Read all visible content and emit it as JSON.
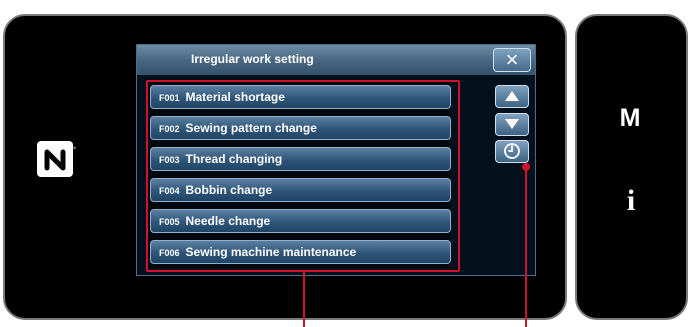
{
  "sidebar": {
    "m_label": "M",
    "info_label": "i"
  },
  "dialog": {
    "title": "Irregular work setting",
    "close_icon": "×",
    "items": [
      {
        "code": "F001",
        "label": "Material shortage"
      },
      {
        "code": "F002",
        "label": "Sewing pattern change"
      },
      {
        "code": "F003",
        "label": "Thread changing"
      },
      {
        "code": "F004",
        "label": "Bobbin change"
      },
      {
        "code": "F005",
        "label": "Needle change"
      },
      {
        "code": "F006",
        "label": "Sewing machine maintenance"
      }
    ],
    "buttons": {
      "up_icon": "up-arrow-icon",
      "down_icon": "down-arrow-icon",
      "clock_icon": "clock-icon"
    }
  },
  "colors": {
    "callout": "#d0122e",
    "panel": "#000000",
    "button": "#2f5578"
  }
}
